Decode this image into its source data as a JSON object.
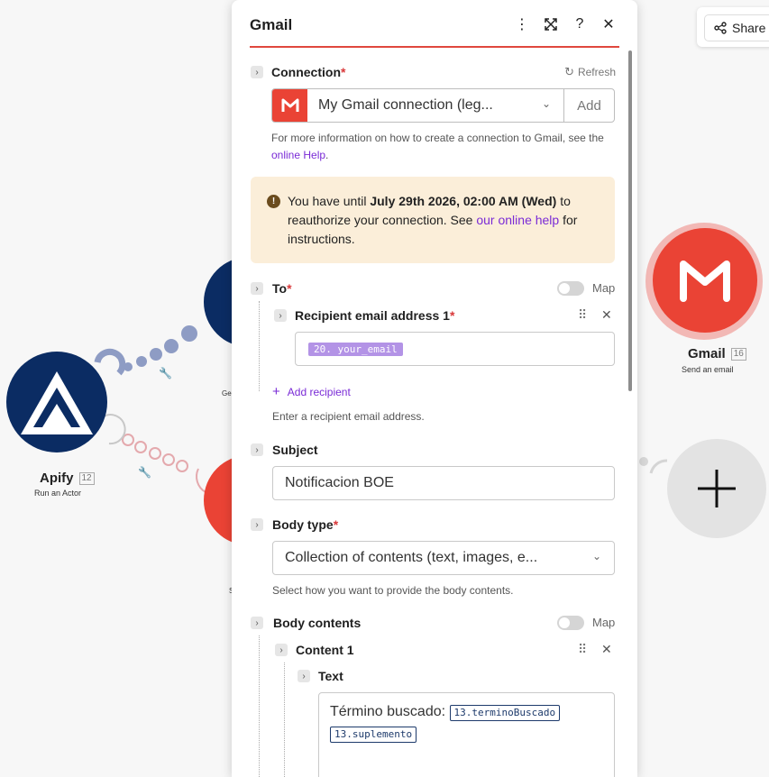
{
  "share": {
    "label": "Share"
  },
  "nodes": {
    "apify": {
      "name": "Apify",
      "badge": "12",
      "sub": "Run an Actor"
    },
    "gmail": {
      "name": "Gmail",
      "badge": "16",
      "sub": "Send an email"
    },
    "partial_labels": {
      "ge": "Ge",
      "s": "S"
    }
  },
  "panel": {
    "title": "Gmail",
    "connection": {
      "label": "Connection",
      "required": "*",
      "refresh": "Refresh",
      "selected": "My Gmail connection (leg...",
      "add": "Add",
      "help_prefix": "For more information on how to create a connection to Gmail, see the ",
      "help_link": "online Help",
      "help_suffix": "."
    },
    "warning": {
      "t1": "You have until ",
      "date": "July 29th 2026, 02:00 AM (Wed)",
      "t2": " to reauthorize your connection. See ",
      "link": "our online help",
      "t3": " for instructions."
    },
    "to": {
      "label": "To",
      "required": "*",
      "map": "Map",
      "recipient_label": "Recipient email address 1",
      "recipient_value": "20. your_email",
      "add_recipient": "Add recipient",
      "help": "Enter a recipient email address."
    },
    "subject": {
      "label": "Subject",
      "value": "Notificacion BOE"
    },
    "body_type": {
      "label": "Body type",
      "required": "*",
      "value": "Collection of contents (text, images, e...",
      "help": "Select how you want to provide the body contents."
    },
    "body_contents": {
      "label": "Body contents",
      "map": "Map",
      "content_label": "Content 1",
      "text_label": "Text",
      "text_prefix": "Término buscado: ",
      "pill1": "13.terminoBuscado",
      "pill2": "13.suplemento"
    }
  },
  "colors": {
    "accent": "#e0483e",
    "gmail_red": "#ea4335",
    "apify_navy": "#0b2c63",
    "link": "#7a2bd6"
  }
}
